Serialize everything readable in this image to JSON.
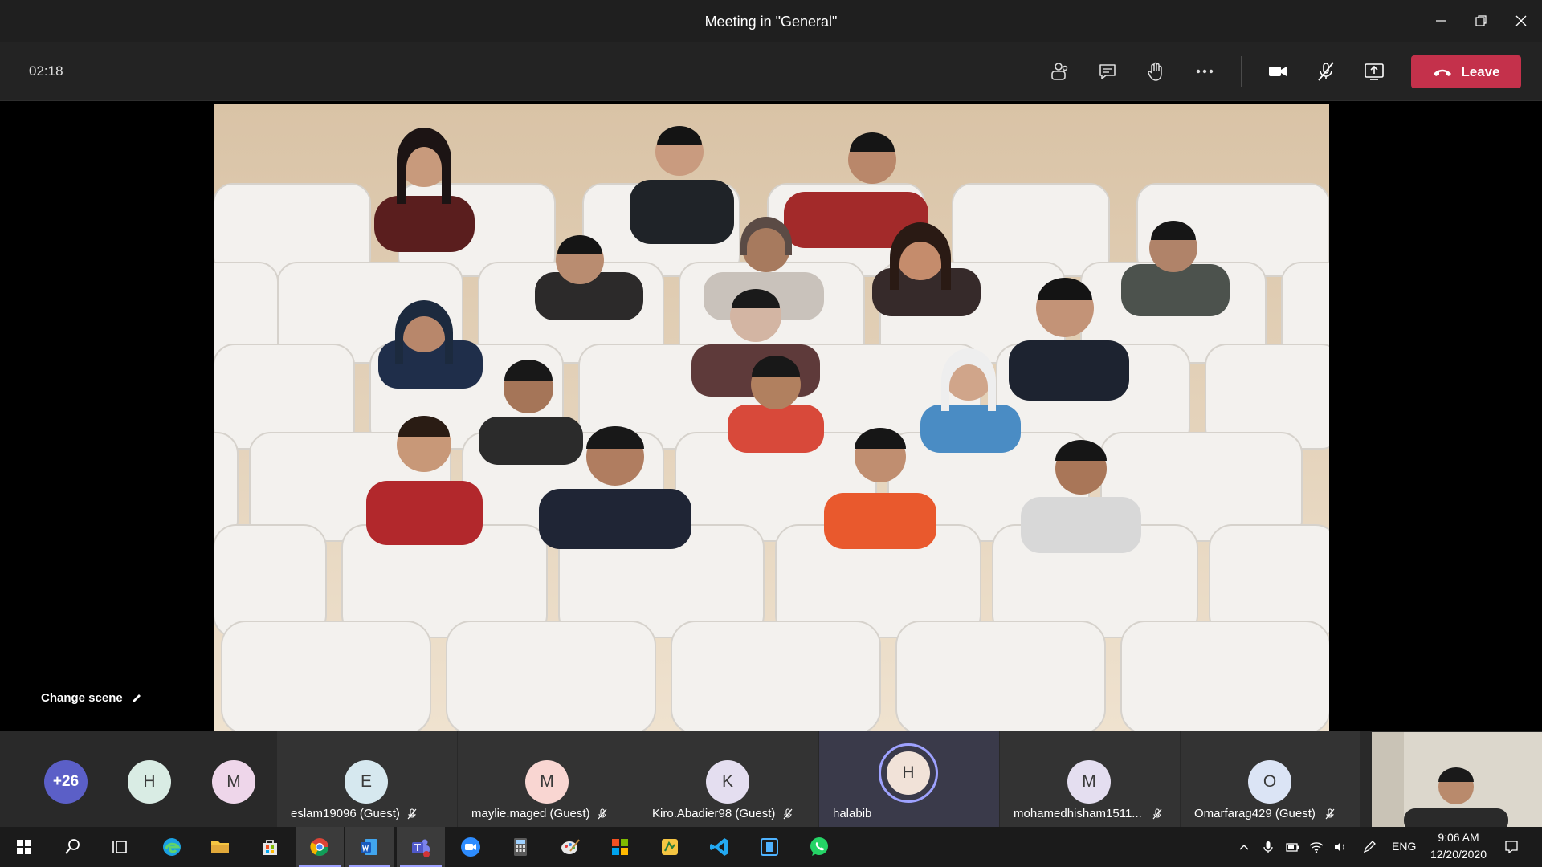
{
  "window": {
    "title": "Meeting in \"General\""
  },
  "toolbar": {
    "timer": "02:18",
    "leave_label": "Leave",
    "buttons": [
      "show-participants",
      "show-conversation",
      "raise-hand",
      "more-actions",
      "camera",
      "mute",
      "share-screen"
    ]
  },
  "stage": {
    "change_scene_label": "Change scene"
  },
  "participants": {
    "more_count": "+26",
    "tiles": [
      {
        "initial": "H",
        "name": "",
        "color": "#d9ece4"
      },
      {
        "initial": "M",
        "name": "",
        "color": "#eed6ea"
      },
      {
        "initial": "E",
        "name": "eslam19096 (Guest)",
        "color": "#d6e8ef"
      },
      {
        "initial": "M",
        "name": "maylie.maged (Guest)",
        "color": "#f9d6d2"
      },
      {
        "initial": "K",
        "name": "Kiro.Abadier98 (Guest)",
        "color": "#e4def0"
      },
      {
        "initial": "H",
        "name": "halabib",
        "color": "#f1e2d8"
      },
      {
        "initial": "M",
        "name": "mohamedhisham1511...",
        "color": "#e4def0"
      },
      {
        "initial": "O",
        "name": "Omarfarag429 (Guest)",
        "color": "#dbe4f5"
      }
    ]
  },
  "taskbar": {
    "language": "ENG",
    "time": "9:06 AM",
    "date": "12/20/2020"
  },
  "colors": {
    "leave": "#c4314b",
    "more_avatar": "#5b5fc7",
    "active_ring": "#9ea2ff"
  }
}
